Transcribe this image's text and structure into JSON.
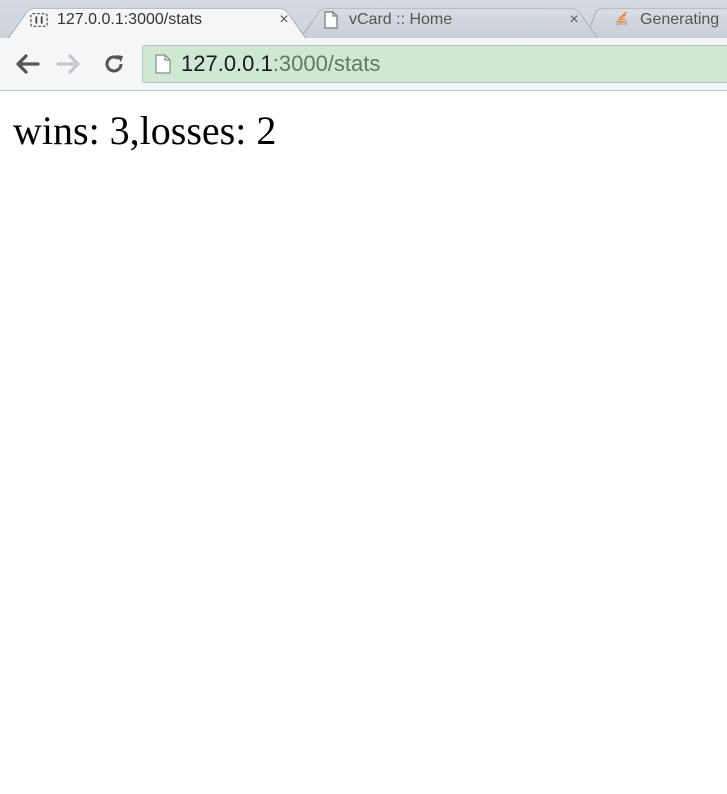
{
  "browser": {
    "tabs": [
      {
        "title": "127.0.0.1:3000/stats",
        "favicon": "loading-icon",
        "active": true,
        "close": "×"
      },
      {
        "title": "vCard :: Home",
        "favicon": "page-icon",
        "active": false,
        "close": "×"
      },
      {
        "title": "Generating",
        "favicon": "stackoverflow-icon",
        "active": false
      }
    ],
    "toolbar": {
      "back": "back-arrow-icon",
      "forward": "forward-arrow-icon",
      "reload": "reload-icon"
    },
    "address": {
      "host": "127.0.0.1",
      "path": ":3000/stats"
    }
  },
  "page": {
    "text": "wins: 3,losses: 2"
  },
  "colors": {
    "omnibox_bg": "#cfe8d3",
    "url_path": "#5e7a62"
  }
}
